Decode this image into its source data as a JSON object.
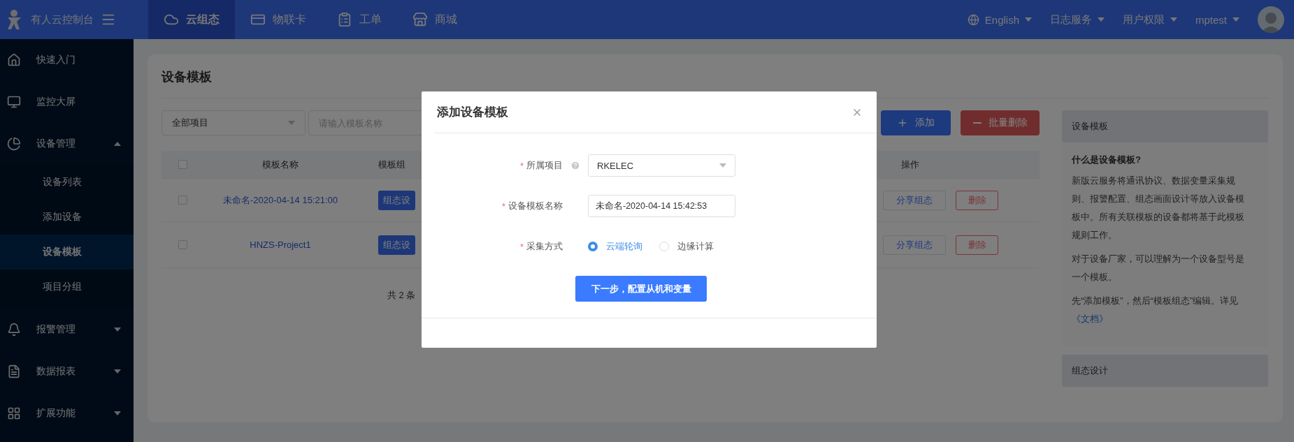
{
  "top_bar": {
    "brand": "有人云控制台",
    "nav": [
      {
        "label": "云组态",
        "selected": true
      },
      {
        "label": "物联卡",
        "selected": false
      },
      {
        "label": "工单",
        "selected": false
      },
      {
        "label": "商城",
        "selected": false
      }
    ],
    "right_menu": [
      {
        "label": "English",
        "kind": "language"
      },
      {
        "label": "日志服务",
        "kind": "menu"
      },
      {
        "label": "用户权限",
        "kind": "menu"
      },
      {
        "label": "mptest",
        "kind": "menu"
      }
    ]
  },
  "sidebar": {
    "items": [
      {
        "kind": "link",
        "label": "快速入门"
      },
      {
        "kind": "link",
        "label": "监控大屏"
      },
      {
        "kind": "group",
        "label": "设备管理",
        "expanded": true,
        "children": [
          {
            "label": "设备列表",
            "selected": false
          },
          {
            "label": "添加设备",
            "selected": false
          },
          {
            "label": "设备模板",
            "selected": true
          },
          {
            "label": "项目分组",
            "selected": false
          }
        ]
      },
      {
        "kind": "group",
        "label": "报警管理",
        "expanded": false
      },
      {
        "kind": "group",
        "label": "数据报表",
        "expanded": false
      },
      {
        "kind": "group",
        "label": "扩展功能",
        "expanded": false
      }
    ]
  },
  "page": {
    "title": "设备模板",
    "project_filter": "全部项目",
    "search": {
      "placeholder": "请输入模板名称"
    },
    "add_button": "添加",
    "batch_delete_button": "批量删除",
    "table": {
      "header_checked": false,
      "columns": [
        "模板名称",
        "模板组",
        "操作"
      ],
      "rows": [
        {
          "checked": false,
          "name": "未命名-2020-04-14 15:21:00",
          "config_button": "组态设",
          "share_button": "分享组态",
          "delete_button": "删除"
        },
        {
          "checked": false,
          "name": "HNZS-Project1",
          "config_button": "组态设",
          "share_button": "分享组态",
          "delete_button": "删除"
        }
      ]
    },
    "total": "共 2 条"
  },
  "help_panel": {
    "title": "设备模板",
    "question": "什么是设备模板?",
    "paragraphs": [
      "新版云服务将通讯协议、数据变量采集规则、报警配置、组态画面设计等放入设备模板中。所有关联模板的设备都将基于此模板规则工作。",
      "对于设备厂家，可以理解为一个设备型号是一个模板。",
      "先“添加模板”，然后“模板组态”编辑。详见"
    ],
    "doc_link": "《文档》",
    "section": "组态设计"
  },
  "dialog": {
    "title": "添加设备模板",
    "fields": [
      {
        "kind": "select",
        "marker": "*",
        "label": "所属项目",
        "help": true,
        "value": "RKELEC"
      },
      {
        "kind": "text",
        "marker": "*",
        "label": "设备模板名称",
        "help": false,
        "value": "未命名-2020-04-14 15:42:53"
      },
      {
        "kind": "radio",
        "marker": "*",
        "label": "采集方式",
        "help": false,
        "options": [
          {
            "label": "云端轮询",
            "selected": true
          },
          {
            "label": "边缘计算",
            "selected": false
          }
        ]
      }
    ],
    "submit": "下一步，配置从机和变量"
  }
}
